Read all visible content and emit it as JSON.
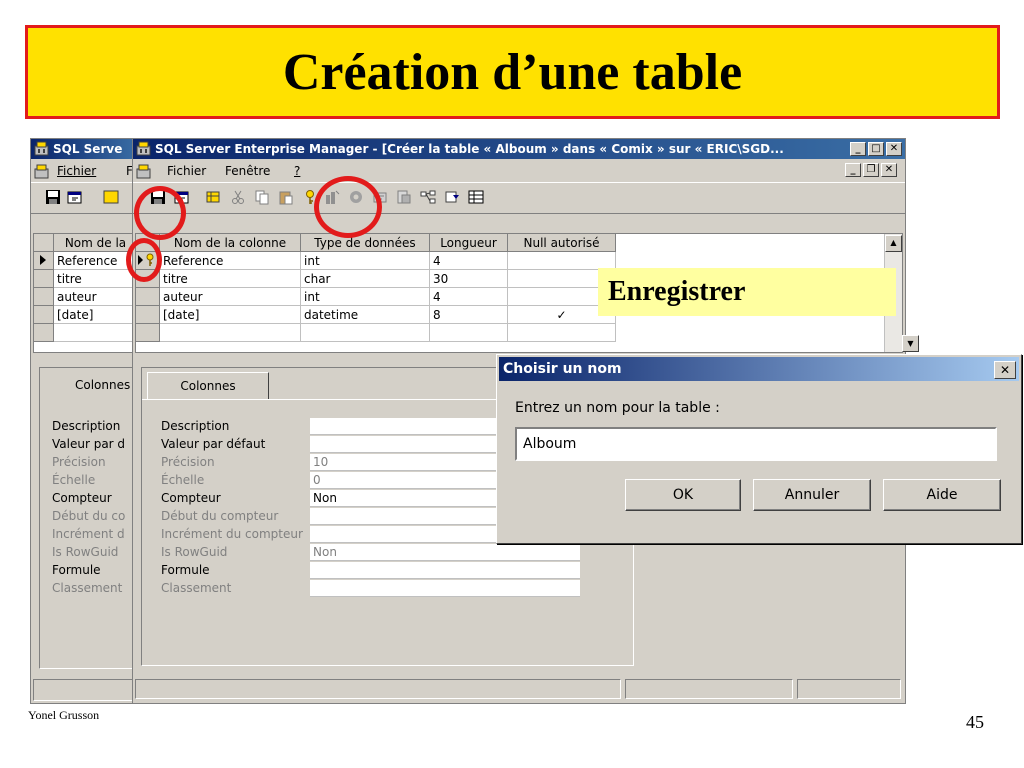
{
  "slide": {
    "title": "Création d’une table",
    "author": "Yonel Grusson",
    "page_number": "45",
    "callout": "Enregistrer"
  },
  "back_window": {
    "title": "SQL Serve",
    "menu": [
      "Fichier",
      "F"
    ],
    "col_header": "Nom de la",
    "rows": [
      "Reference",
      "titre",
      "auteur",
      "[date]"
    ],
    "tab": "Colonnes",
    "props": [
      "Description",
      "Valeur par d",
      "Précision",
      "Échelle",
      "Compteur",
      "Début du co",
      "Incrément d",
      "Is RowGuid",
      "Formule",
      "Classement"
    ]
  },
  "main_window": {
    "title": "SQL Server Enterprise Manager - [Créer la table « Alboum » dans « Comix » sur « ERIC\\SGD...",
    "menu": {
      "file": "Fichier",
      "window": "Fenêtre",
      "help": "?"
    },
    "columns": [
      "Nom de la colonne",
      "Type de données",
      "Longueur",
      "Null autorisé"
    ],
    "rows": [
      {
        "name": "Reference",
        "type": "int",
        "length": "4",
        "nullable": ""
      },
      {
        "name": "titre",
        "type": "char",
        "length": "30",
        "nullable": ""
      },
      {
        "name": "auteur",
        "type": "int",
        "length": "4",
        "nullable": ""
      },
      {
        "name": "[date]",
        "type": "datetime",
        "length": "8",
        "nullable": "✓"
      }
    ],
    "tab": "Colonnes",
    "props": [
      {
        "label": "Description",
        "value": "",
        "disabled": false
      },
      {
        "label": "Valeur par défaut",
        "value": "",
        "disabled": false
      },
      {
        "label": "Précision",
        "value": "10",
        "disabled": true
      },
      {
        "label": "Échelle",
        "value": "0",
        "disabled": true
      },
      {
        "label": "Compteur",
        "value": "Non",
        "disabled": false
      },
      {
        "label": "Début du compteur",
        "value": "",
        "disabled": true
      },
      {
        "label": "Incrément du compteur",
        "value": "",
        "disabled": true
      },
      {
        "label": "Is RowGuid",
        "value": "Non",
        "disabled": true
      },
      {
        "label": "Formule",
        "value": "",
        "disabled": false
      },
      {
        "label": "Classement",
        "value": "",
        "disabled": true
      }
    ]
  },
  "dialog": {
    "title": "Choisir un nom",
    "prompt": "Entrez un nom pour la table :",
    "input_value": "Alboum",
    "ok": "OK",
    "cancel": "Annuler",
    "help": "Aide"
  }
}
